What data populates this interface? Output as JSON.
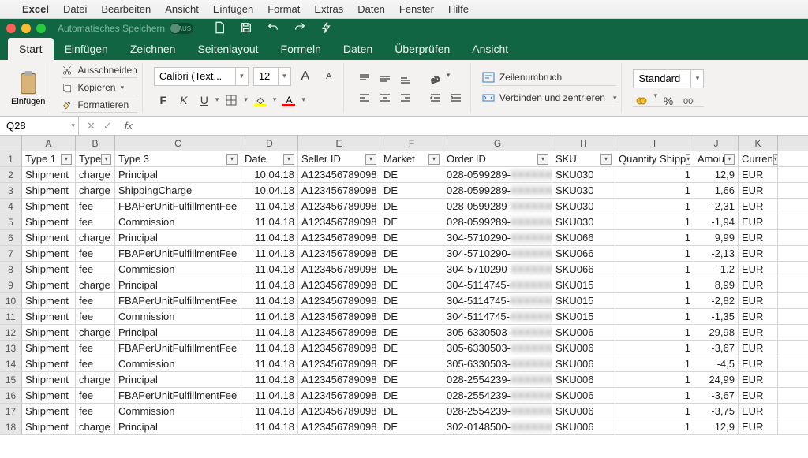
{
  "mac_menu": {
    "app": "Excel",
    "items": [
      "Datei",
      "Bearbeiten",
      "Ansicht",
      "Einfügen",
      "Format",
      "Extras",
      "Daten",
      "Fenster",
      "Hilfe"
    ]
  },
  "titlebar": {
    "autosave_label": "Automatisches Speichern",
    "autosave_state": "AUS"
  },
  "tabs": [
    "Start",
    "Einfügen",
    "Zeichnen",
    "Seitenlayout",
    "Formeln",
    "Daten",
    "Überprüfen",
    "Ansicht"
  ],
  "active_tab": "Start",
  "ribbon": {
    "paste": "Einfügen",
    "cut": "Ausschneiden",
    "copy": "Kopieren",
    "format_painter": "Formatieren",
    "font_name": "Calibri (Text...",
    "font_size": "12",
    "wrap": "Zeilenumbruch",
    "merge": "Verbinden und zentrieren",
    "number_format": "Standard",
    "percent": "%"
  },
  "namebox": "Q28",
  "fx": "fx",
  "columns": [
    "A",
    "B",
    "C",
    "D",
    "E",
    "F",
    "G",
    "H",
    "I",
    "J",
    "K"
  ],
  "headers": {
    "A": "Type 1",
    "B": "Type",
    "C": "Type 3",
    "D": "Date",
    "E": "Seller ID",
    "F": "Market",
    "G": "Order ID",
    "H": "SKU",
    "I": "Quantity Shipp",
    "J": "Amou",
    "K": "Curren"
  },
  "rows": [
    {
      "n": 2,
      "A": "Shipment",
      "B": "charge",
      "C": "Principal",
      "D": "10.04.18",
      "E": "A123456789098",
      "F": "DE",
      "G1": "028-0599289-",
      "G2": "XXXXXXX",
      "H": "SKU030",
      "I": "1",
      "J": "12,9",
      "K": "EUR"
    },
    {
      "n": 3,
      "A": "Shipment",
      "B": "charge",
      "C": "ShippingCharge",
      "D": "10.04.18",
      "E": "A123456789098",
      "F": "DE",
      "G1": "028-0599289-",
      "G2": "XXXXXXX",
      "H": "SKU030",
      "I": "1",
      "J": "1,66",
      "K": "EUR"
    },
    {
      "n": 4,
      "A": "Shipment",
      "B": "fee",
      "C": "FBAPerUnitFulfillmentFee",
      "D": "11.04.18",
      "E": "A123456789098",
      "F": "DE",
      "G1": "028-0599289-",
      "G2": "XXXXXXX",
      "H": "SKU030",
      "I": "1",
      "J": "-2,31",
      "K": "EUR"
    },
    {
      "n": 5,
      "A": "Shipment",
      "B": "fee",
      "C": "Commission",
      "D": "11.04.18",
      "E": "A123456789098",
      "F": "DE",
      "G1": "028-0599289-",
      "G2": "XXXXXXX",
      "H": "SKU030",
      "I": "1",
      "J": "-1,94",
      "K": "EUR"
    },
    {
      "n": 6,
      "A": "Shipment",
      "B": "charge",
      "C": "Principal",
      "D": "11.04.18",
      "E": "A123456789098",
      "F": "DE",
      "G1": "304-5710290-",
      "G2": "XXXXXXX",
      "H": "SKU066",
      "I": "1",
      "J": "9,99",
      "K": "EUR"
    },
    {
      "n": 7,
      "A": "Shipment",
      "B": "fee",
      "C": "FBAPerUnitFulfillmentFee",
      "D": "11.04.18",
      "E": "A123456789098",
      "F": "DE",
      "G1": "304-5710290-",
      "G2": "XXXXXXX",
      "H": "SKU066",
      "I": "1",
      "J": "-2,13",
      "K": "EUR"
    },
    {
      "n": 8,
      "A": "Shipment",
      "B": "fee",
      "C": "Commission",
      "D": "11.04.18",
      "E": "A123456789098",
      "F": "DE",
      "G1": "304-5710290-",
      "G2": "XXXXXXX",
      "H": "SKU066",
      "I": "1",
      "J": "-1,2",
      "K": "EUR"
    },
    {
      "n": 9,
      "A": "Shipment",
      "B": "charge",
      "C": "Principal",
      "D": "11.04.18",
      "E": "A123456789098",
      "F": "DE",
      "G1": "304-5114745-",
      "G2": "XXXXXXX",
      "H": "SKU015",
      "I": "1",
      "J": "8,99",
      "K": "EUR"
    },
    {
      "n": 10,
      "A": "Shipment",
      "B": "fee",
      "C": "FBAPerUnitFulfillmentFee",
      "D": "11.04.18",
      "E": "A123456789098",
      "F": "DE",
      "G1": "304-5114745-",
      "G2": "XXXXXXX",
      "H": "SKU015",
      "I": "1",
      "J": "-2,82",
      "K": "EUR"
    },
    {
      "n": 11,
      "A": "Shipment",
      "B": "fee",
      "C": "Commission",
      "D": "11.04.18",
      "E": "A123456789098",
      "F": "DE",
      "G1": "304-5114745-",
      "G2": "XXXXXXX",
      "H": "SKU015",
      "I": "1",
      "J": "-1,35",
      "K": "EUR"
    },
    {
      "n": 12,
      "A": "Shipment",
      "B": "charge",
      "C": "Principal",
      "D": "11.04.18",
      "E": "A123456789098",
      "F": "DE",
      "G1": "305-6330503-",
      "G2": "XXXXXXX",
      "H": "SKU006",
      "I": "1",
      "J": "29,98",
      "K": "EUR"
    },
    {
      "n": 13,
      "A": "Shipment",
      "B": "fee",
      "C": "FBAPerUnitFulfillmentFee",
      "D": "11.04.18",
      "E": "A123456789098",
      "F": "DE",
      "G1": "305-6330503-",
      "G2": "XXXXXXX",
      "H": "SKU006",
      "I": "1",
      "J": "-3,67",
      "K": "EUR"
    },
    {
      "n": 14,
      "A": "Shipment",
      "B": "fee",
      "C": "Commission",
      "D": "11.04.18",
      "E": "A123456789098",
      "F": "DE",
      "G1": "305-6330503-",
      "G2": "XXXXXXX",
      "H": "SKU006",
      "I": "1",
      "J": "-4,5",
      "K": "EUR"
    },
    {
      "n": 15,
      "A": "Shipment",
      "B": "charge",
      "C": "Principal",
      "D": "11.04.18",
      "E": "A123456789098",
      "F": "DE",
      "G1": "028-2554239-",
      "G2": "XXXXXXX",
      "H": "SKU006",
      "I": "1",
      "J": "24,99",
      "K": "EUR"
    },
    {
      "n": 16,
      "A": "Shipment",
      "B": "fee",
      "C": "FBAPerUnitFulfillmentFee",
      "D": "11.04.18",
      "E": "A123456789098",
      "F": "DE",
      "G1": "028-2554239-",
      "G2": "XXXXXXX",
      "H": "SKU006",
      "I": "1",
      "J": "-3,67",
      "K": "EUR"
    },
    {
      "n": 17,
      "A": "Shipment",
      "B": "fee",
      "C": "Commission",
      "D": "11.04.18",
      "E": "A123456789098",
      "F": "DE",
      "G1": "028-2554239-",
      "G2": "XXXXXXX",
      "H": "SKU006",
      "I": "1",
      "J": "-3,75",
      "K": "EUR"
    },
    {
      "n": 18,
      "A": "Shipment",
      "B": "charge",
      "C": "Principal",
      "D": "11.04.18",
      "E": "A123456789098",
      "F": "DE",
      "G1": "302-0148500-",
      "G2": "XXXXXXX",
      "H": "SKU006",
      "I": "1",
      "J": "12,9",
      "K": "EUR"
    }
  ]
}
